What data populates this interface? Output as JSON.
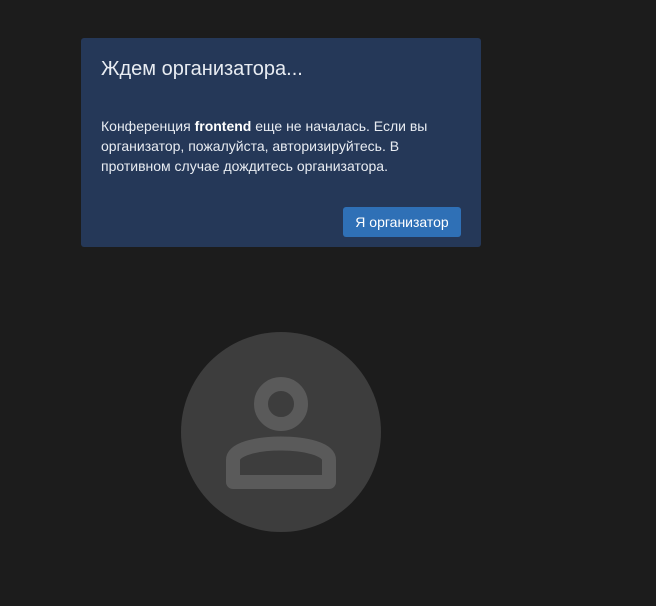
{
  "dialog": {
    "title": "Ждем организатора...",
    "body_prefix": "Конференция ",
    "room_name": "frontend",
    "body_suffix": " еще не началась. Если вы организатор, пожалуйста, авторизируйтесь. В противном случае дождитесь организатора.",
    "button_label": "Я организатор"
  },
  "avatar": {
    "icon": "user-silhouette-icon"
  },
  "colors": {
    "background": "#1c1c1c",
    "dialog_background": "#253858",
    "button_background": "#2f70b6",
    "avatar_background": "#3d3d3d",
    "avatar_icon": "#5a5a5a"
  }
}
